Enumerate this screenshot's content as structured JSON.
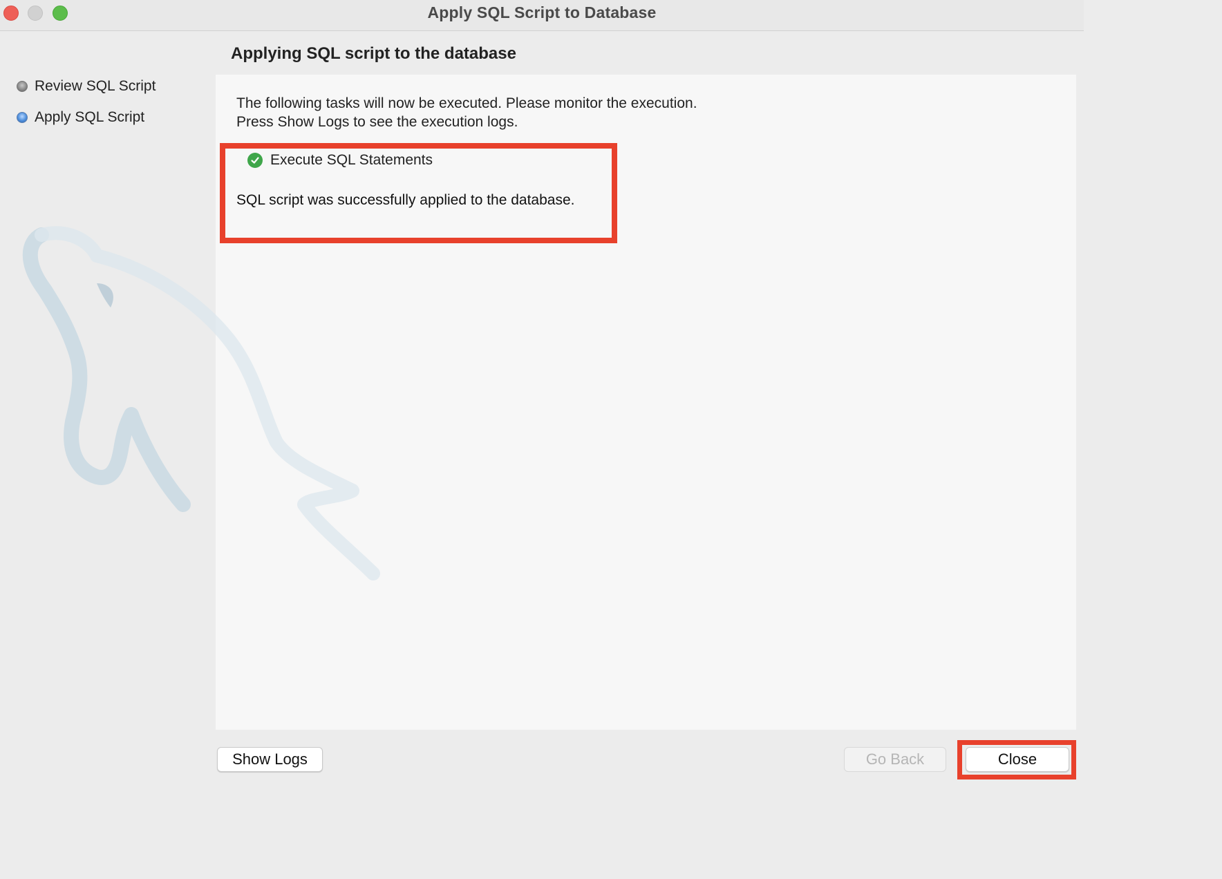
{
  "window": {
    "title": "Apply SQL Script to Database"
  },
  "sidebar": {
    "steps": [
      {
        "label": "Review SQL Script",
        "state": "inactive"
      },
      {
        "label": "Apply SQL Script",
        "state": "active"
      }
    ]
  },
  "main": {
    "heading": "Applying SQL script to the database",
    "intro_line1": "The following tasks will now be executed. Please monitor the execution.",
    "intro_line2": "Press Show Logs to see the execution logs.",
    "task": {
      "label": "Execute SQL Statements",
      "status_icon": "check-circle-icon"
    },
    "result_message": "SQL script was successfully applied to the database."
  },
  "buttons": {
    "show_logs": "Show Logs",
    "go_back": "Go Back",
    "close": "Close"
  },
  "colors": {
    "highlight": "#e8412c",
    "success": "#3fa64a",
    "active_step": "#4f8fdc"
  }
}
